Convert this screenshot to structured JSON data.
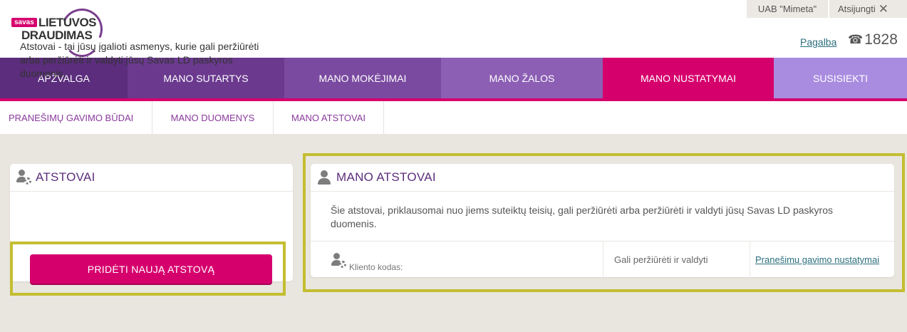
{
  "logo": {
    "savas": "savas",
    "line1": "LIETUVOS",
    "line2": "DRAUDIMAS"
  },
  "header": {
    "company": "UAB \"Mimeta\"",
    "logout": "Atsijungti",
    "help": "Pagalba",
    "phone": "1828"
  },
  "mainnav": [
    {
      "label": "APŽVALGA",
      "color": "#5b2d7c"
    },
    {
      "label": "MANO SUTARTYS",
      "color": "#6b3a8f"
    },
    {
      "label": "MANO MOKĖJIMAI",
      "color": "#7a4aa0"
    },
    {
      "label": "MANO ŽALOS",
      "color": "#8c5fb4"
    },
    {
      "label": "MANO NUSTATYMAI",
      "color": "#d6006d"
    },
    {
      "label": "SUSISIEKTI",
      "color": "#a98ce0"
    }
  ],
  "subnav": [
    {
      "label": "PRANEŠIMŲ GAVIMO BŪDAI"
    },
    {
      "label": "MANO DUOMENYS"
    },
    {
      "label": "MANO ATSTOVAI"
    }
  ],
  "left_panel": {
    "title": "ATSTOVAI",
    "description": "Atstovai - tai jūsų įgalioti asmenys, kurie gali peržiūrėti arba peržiūrėti ir valdyti jūsų Savas LD paskyros duomenis.",
    "button": "PRIDĖTI NAUJĄ ATSTOVĄ"
  },
  "right_panel": {
    "title": "MANO ATSTOVAI",
    "description": "Šie atstovai, priklausomai nuo jiems suteiktų teisių, gali peržiūrėti arba peržiūrėti ir valdyti jūsų Savas LD paskyros duomenis.",
    "row": {
      "client_code_label": "Kliento kodas:",
      "rights": "Gali peržiūrėti ir valdyti",
      "notifications_link": "Pranešimų gavimo nustatymai"
    }
  },
  "colors": {
    "brand_magenta": "#d6006d",
    "brand_purple": "#5b2d7c",
    "highlight": "#c4be31"
  }
}
